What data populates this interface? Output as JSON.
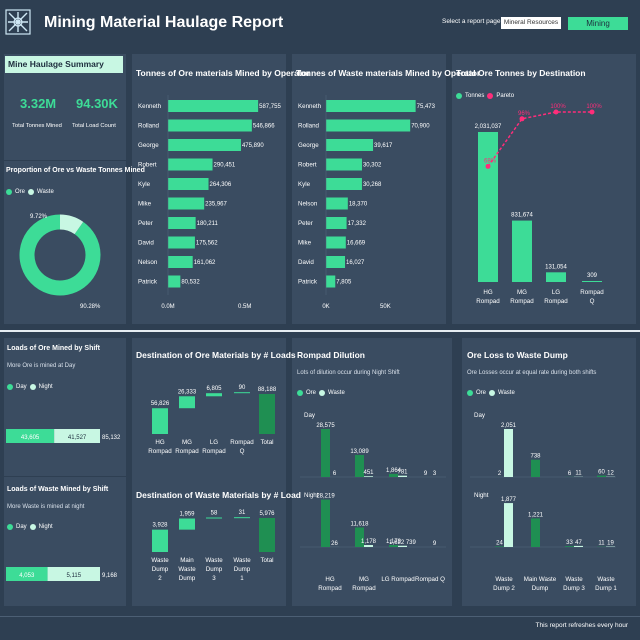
{
  "header": {
    "title": "Mining Material Haulage Report",
    "select_label": "Select a report page:",
    "btn_mineral": "Mineral Resources",
    "btn_mining": "Mining"
  },
  "footer": {
    "note": "This report refreshes every hour"
  },
  "colors": {
    "accent": "#3ddc97",
    "light": "#c8f7e3",
    "dark": "#1f8f52",
    "pareto": "#ff2d7a",
    "bg": "#2e3f52",
    "panel": "#3a4c61"
  },
  "summary": {
    "title": "Mine Haulage Summary",
    "total_tonnes": "3.32M",
    "total_tonnes_label": "Total Tonnes Mined",
    "total_loads": "94.30K",
    "total_loads_label": "Total Load Count"
  },
  "legend": {
    "ore": "Ore",
    "waste": "Waste",
    "day": "Day",
    "night": "Night",
    "tonnes": "Tonnes",
    "pareto": "Pareto"
  },
  "chart_data": [
    {
      "id": "ore_waste_donut",
      "type": "pie",
      "title": "Proportion of Ore vs Waste Tonnes Mined",
      "categories": [
        "Ore",
        "Waste"
      ],
      "values": [
        90.28,
        9.72
      ],
      "labels": [
        "90.28%",
        "9.72%"
      ]
    },
    {
      "id": "ore_by_operator",
      "type": "bar",
      "title": "Tonnes of Ore materials Mined by Operator",
      "categories": [
        "Kenneth",
        "Rolland",
        "George",
        "Robert",
        "Kyle",
        "Mike",
        "Peter",
        "David",
        "Nelson",
        "Patrick"
      ],
      "values": [
        587755,
        546866,
        475890,
        290451,
        264306,
        235967,
        180211,
        175562,
        161062,
        80532
      ],
      "labels": [
        "587,755",
        "546,866",
        "475,890",
        "290,451",
        "264,306",
        "235,967",
        "180,211",
        "175,562",
        "161,062",
        "80,532"
      ],
      "xlim": [
        0,
        600000
      ],
      "xticks": [
        "0.0M",
        "0.5M"
      ]
    },
    {
      "id": "waste_by_operator",
      "type": "bar",
      "title": "Tonnes of Waste materials Mined by Operator",
      "categories": [
        "Kenneth",
        "Rolland",
        "George",
        "Robert",
        "Kyle",
        "Nelson",
        "Peter",
        "Mike",
        "David",
        "Patrick"
      ],
      "values": [
        75473,
        70900,
        39617,
        30302,
        30268,
        18370,
        17332,
        16669,
        16027,
        7805
      ],
      "labels": [
        "75,473",
        "70,900",
        "39,617",
        "30,302",
        "30,268",
        "18,370",
        "17,332",
        "16,669",
        "16,027",
        "7,805"
      ],
      "xlim": [
        0,
        78000
      ],
      "xticks": [
        "0K",
        "50K"
      ]
    },
    {
      "id": "ore_by_destination",
      "type": "bar",
      "title": "Total Ore Tonnes by Destination",
      "categories": [
        "HG Rompad",
        "MG Rompad",
        "LG Rompad",
        "Rompad Q"
      ],
      "values": [
        2031037,
        831674,
        131054,
        309
      ],
      "labels": [
        "2,031,037",
        "831,674",
        "131,054",
        "309"
      ],
      "pareto": [
        68,
        96,
        100,
        100
      ],
      "pareto_labels": [
        "68%",
        "96%",
        "100%",
        "100%"
      ]
    },
    {
      "id": "ore_by_shift",
      "type": "bar",
      "title": "Loads of Ore Mined by Shift",
      "subtitle": "More Ore is mined at Day",
      "series": [
        {
          "name": "Day",
          "values": [
            43605
          ],
          "label": "43,605"
        },
        {
          "name": "Night",
          "values": [
            41527
          ],
          "label": "41,527"
        }
      ],
      "total": 85132,
      "total_label": "85,132"
    },
    {
      "id": "waste_by_shift",
      "type": "bar",
      "title": "Loads of Waste Mined by Shift",
      "subtitle": "More Waste is mined at night",
      "series": [
        {
          "name": "Day",
          "values": [
            4053
          ],
          "label": "4,053"
        },
        {
          "name": "Night",
          "values": [
            5115
          ],
          "label": "5,115"
        }
      ],
      "total": 9168,
      "total_label": "9,168"
    },
    {
      "id": "ore_loads_waterfall",
      "type": "bar",
      "title": "Destination of Ore Materials by # Loads",
      "categories": [
        "HG Rompad",
        "MG Rompad",
        "LG Rompad",
        "Rompad Q",
        "Total"
      ],
      "values": [
        56826,
        26333,
        6805,
        90,
        88188
      ],
      "labels": [
        "56,826",
        "26,333",
        "6,805",
        "90",
        "88,188"
      ]
    },
    {
      "id": "waste_loads_waterfall",
      "type": "bar",
      "title": "Destination of Waste Materials by # Load",
      "categories": [
        "Waste Dump 2",
        "Main Waste Dump",
        "Waste Dump 3",
        "Waste Dump 1",
        "Total"
      ],
      "values": [
        3928,
        1959,
        58,
        31,
        5976
      ],
      "labels": [
        "3,928",
        "1,959",
        "58",
        "31",
        "5,976"
      ]
    },
    {
      "id": "rompad_dilution",
      "type": "bar",
      "title": "Rompad Dilution",
      "subtitle": "Lots of dilution occur during Night Shift",
      "categories": [
        "HG Rompad",
        "MG Rompad",
        "LG Rompad",
        "Rompad Q"
      ],
      "panels": [
        {
          "name": "Day",
          "ore": [
            28575,
            13089,
            1864,
            9
          ],
          "waste": [
            6,
            451,
            781,
            3
          ],
          "ore_labels": [
            "28,575",
            "13,089",
            "1,864",
            "9"
          ],
          "waste_labels": [
            "6",
            "451",
            "781",
            "3"
          ]
        },
        {
          "name": "Night",
          "ore": [
            28219,
            11618,
            1178,
            0
          ],
          "waste": [
            26,
            1178,
            739,
            9
          ],
          "ore_labels": [
            "28,219",
            "11,618",
            "1,178",
            ""
          ],
          "waste_labels": [
            "26",
            "1,178",
            "1,622 739",
            "9"
          ]
        }
      ]
    },
    {
      "id": "ore_loss_dump",
      "type": "bar",
      "title": "Ore Loss to Waste Dump",
      "subtitle": "Ore Losses occur at equal rate during both shifts",
      "categories": [
        "Waste Dump 2",
        "Main Waste Dump",
        "Waste Dump 3",
        "Waste Dump 1"
      ],
      "panels": [
        {
          "name": "Day",
          "ore": [
            2,
            738,
            6,
            60
          ],
          "waste": [
            2051,
            0,
            11,
            12
          ],
          "ore_labels": [
            "2",
            "738",
            "6",
            "60"
          ],
          "waste_labels": [
            "2,051",
            "",
            "11",
            "12"
          ]
        },
        {
          "name": "Night",
          "ore": [
            24,
            1221,
            33,
            11
          ],
          "waste": [
            1877,
            0,
            47,
            19
          ],
          "ore_labels": [
            "24",
            "1,221",
            "33",
            "11"
          ],
          "waste_labels": [
            "1,877",
            "",
            "47",
            "19"
          ]
        }
      ]
    }
  ]
}
